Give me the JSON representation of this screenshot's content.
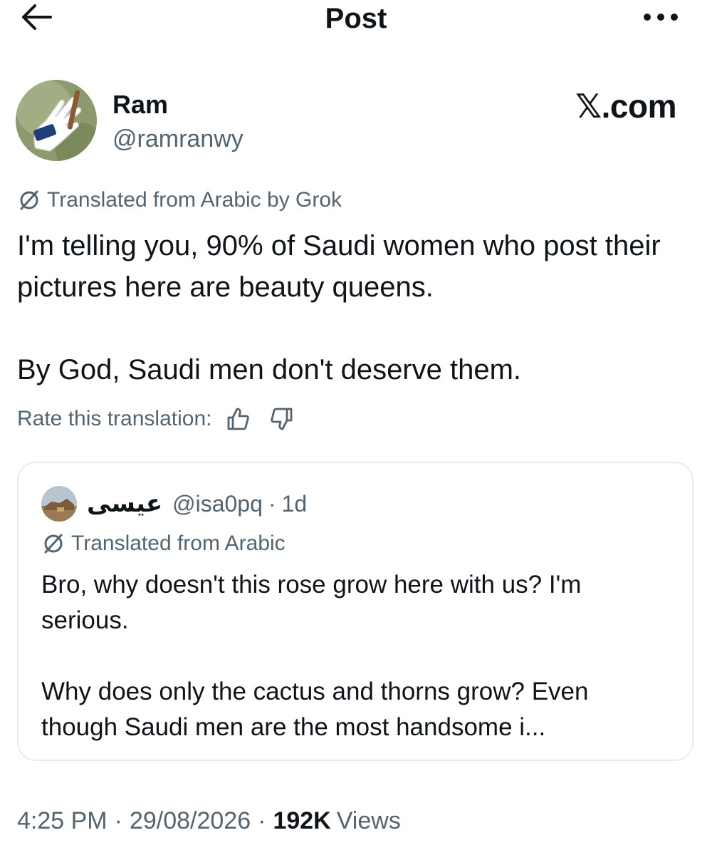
{
  "header": {
    "back_icon": "arrow-left-icon",
    "title": "Post",
    "more_icon": "more-horizontal-icon"
  },
  "author": {
    "display_name": "Ram",
    "handle": "@ramranwy"
  },
  "watermark": "𝕏.com",
  "post": {
    "translation_note": "Translated from Arabic by Grok",
    "translation_icon": "translate-slash-icon",
    "paragraphs": [
      "I'm telling you, 90% of Saudi women who post their pictures here are beauty queens.",
      "By God, Saudi men don't deserve them."
    ],
    "rate_label": "Rate this translation:",
    "thumbs_up_icon": "thumbs-up-icon",
    "thumbs_down_icon": "thumbs-down-icon"
  },
  "quote": {
    "display_name": "عيسى",
    "handle": "@isa0pq",
    "separator": "·",
    "time": "1d",
    "translation_note": "Translated from Arabic",
    "paragraphs": [
      "Bro, why doesn't this rose grow here with us? I'm serious.",
      "Why does only the cactus and thorns grow? Even though Saudi men are the most handsome i..."
    ]
  },
  "meta": {
    "time": "4:25 PM",
    "sep": "·",
    "date": "29/08/2026",
    "views_count": "192K",
    "views_label": "Views"
  },
  "colors": {
    "text_primary": "#0f1419",
    "text_secondary": "#536471",
    "border": "#e6ebee",
    "background": "#ffffff"
  }
}
